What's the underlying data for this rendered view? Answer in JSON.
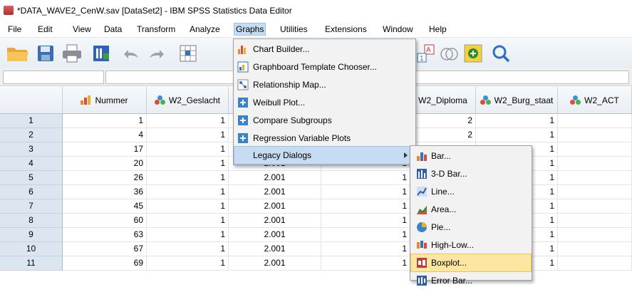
{
  "window": {
    "title": "*DATA_WAVE2_CenW.sav [DataSet2] - IBM SPSS Statistics Data Editor"
  },
  "menubar": {
    "items": [
      "File",
      "Edit",
      "View",
      "Data",
      "Transform",
      "Analyze",
      "Graphs",
      "Utilities",
      "Extensions",
      "Window",
      "Help"
    ],
    "active": "Graphs"
  },
  "toolbar": {
    "icons": [
      "open-folder-icon",
      "save-icon",
      "print-icon",
      "recall-dialog-icon",
      "undo-icon",
      "redo-icon",
      "go-to-case-icon",
      "value-labels-icon",
      "use-sets-icon",
      "spelling-icon",
      "search-icon"
    ]
  },
  "graphs_menu": {
    "items": [
      {
        "label": "Chart Builder...",
        "icon": "chart-builder-icon"
      },
      {
        "label": "Graphboard Template Chooser...",
        "icon": "graphboard-icon"
      },
      {
        "label": "Relationship Map...",
        "icon": "relationship-map-icon"
      },
      {
        "label": "Weibull Plot...",
        "icon": "weibull-plot-icon"
      },
      {
        "label": "Compare Subgroups",
        "icon": "compare-subgroups-icon"
      },
      {
        "label": "Regression Variable Plots",
        "icon": "regression-plots-icon"
      },
      {
        "label": "Legacy Dialogs",
        "icon": "none",
        "submenu": true
      }
    ],
    "active": "Legacy Dialogs"
  },
  "legacy_menu": {
    "items": [
      {
        "label": "Bar...",
        "icon": "bar-chart-icon"
      },
      {
        "label": "3-D Bar...",
        "icon": "3d-bar-chart-icon"
      },
      {
        "label": "Line...",
        "icon": "line-chart-icon"
      },
      {
        "label": "Area...",
        "icon": "area-chart-icon"
      },
      {
        "label": "Pie...",
        "icon": "pie-chart-icon"
      },
      {
        "label": "High-Low...",
        "icon": "high-low-chart-icon"
      },
      {
        "label": "Boxplot...",
        "icon": "boxplot-icon"
      },
      {
        "label": "Error Bar...",
        "icon": "error-bar-icon"
      }
    ],
    "active": "Boxplot..."
  },
  "grid": {
    "columns": [
      {
        "name": "Nummer",
        "measure": "scale"
      },
      {
        "name": "W2_Geslacht",
        "measure": "nominal"
      },
      {
        "name": "",
        "measure": "hidden"
      },
      {
        "name": "",
        "measure": "hidden"
      },
      {
        "name": "W2_Diploma",
        "measure": "hidden"
      },
      {
        "name": "W2_Burg_staat",
        "measure": "nominal"
      },
      {
        "name": "W2_ACT",
        "measure": "nominal"
      }
    ],
    "rows": [
      {
        "n": "1",
        "cells": [
          "1",
          "1",
          "",
          "",
          "2",
          "1",
          ""
        ]
      },
      {
        "n": "2",
        "cells": [
          "4",
          "1",
          "",
          "",
          "2",
          "1",
          ""
        ]
      },
      {
        "n": "3",
        "cells": [
          "17",
          "1",
          "",
          "",
          "",
          "1",
          ""
        ]
      },
      {
        "n": "4",
        "cells": [
          "20",
          "1",
          "2.001",
          "1",
          "",
          "1",
          ""
        ]
      },
      {
        "n": "5",
        "cells": [
          "26",
          "1",
          "2.001",
          "1",
          "",
          "1",
          ""
        ]
      },
      {
        "n": "6",
        "cells": [
          "36",
          "1",
          "2.001",
          "1",
          "",
          "1",
          ""
        ]
      },
      {
        "n": "7",
        "cells": [
          "45",
          "1",
          "2.001",
          "1",
          "",
          "1",
          ""
        ]
      },
      {
        "n": "8",
        "cells": [
          "60",
          "1",
          "2.001",
          "1",
          "",
          "1",
          ""
        ]
      },
      {
        "n": "9",
        "cells": [
          "63",
          "1",
          "2.001",
          "1",
          "",
          "1",
          ""
        ]
      },
      {
        "n": "10",
        "cells": [
          "67",
          "1",
          "2.001",
          "1",
          "",
          "1",
          ""
        ]
      },
      {
        "n": "11",
        "cells": [
          "69",
          "1",
          "2.001",
          "1",
          "",
          "1",
          ""
        ]
      }
    ]
  },
  "colors": {
    "menu_highlight": "#c6dcf3",
    "submenu_highlight": "#fbe7a1",
    "row_header": "#dbe6f1"
  }
}
